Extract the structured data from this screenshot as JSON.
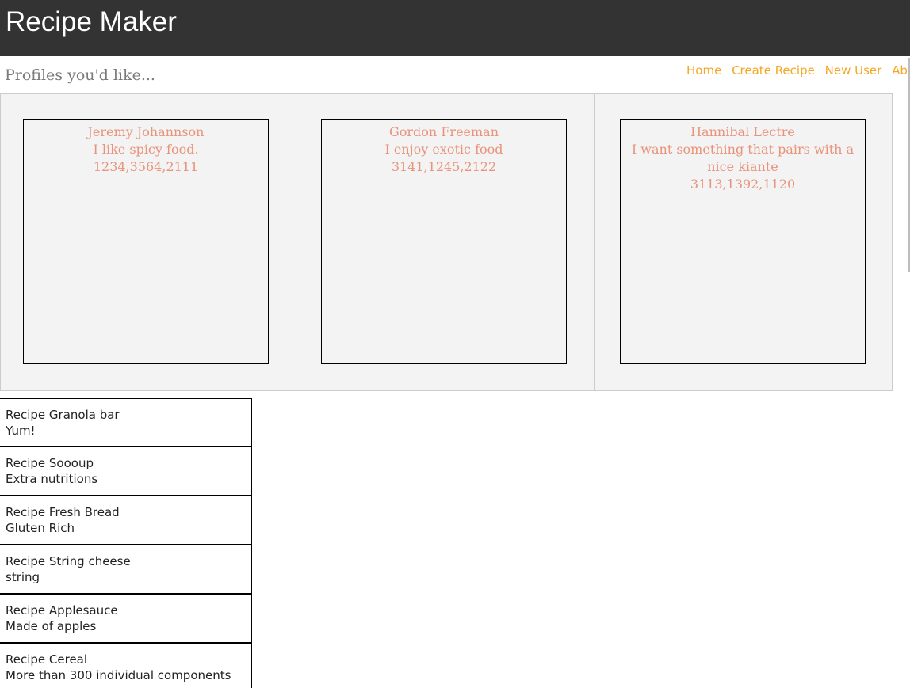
{
  "header": {
    "title": "Recipe Maker"
  },
  "subtitle": "Profiles you'd like...",
  "nav": {
    "items": [
      {
        "label": "Home"
      },
      {
        "label": "Create Recipe"
      },
      {
        "label": "New User"
      },
      {
        "label": "About"
      }
    ]
  },
  "profiles": [
    {
      "name": "Jeremy Johannson",
      "bio": "I like spicy food.",
      "ids": "1234,3564,2111"
    },
    {
      "name": "Gordon Freeman",
      "bio": "I enjoy exotic food",
      "ids": "3141,1245,2122"
    },
    {
      "name": "Hannibal Lectre",
      "bio": "I want something that pairs with a nice kiante",
      "ids": "3113,1392,1120"
    }
  ],
  "recipes": [
    {
      "title": "Recipe Granola bar",
      "description": "Yum!"
    },
    {
      "title": "Recipe Soooup",
      "description": "Extra nutritions"
    },
    {
      "title": "Recipe Fresh Bread",
      "description": "Gluten Rich"
    },
    {
      "title": "Recipe String cheese",
      "description": "string"
    },
    {
      "title": "Recipe Applesauce",
      "description": "Made of apples"
    },
    {
      "title": "Recipe Cereal",
      "description": "More than 300 individual components"
    }
  ],
  "colors": {
    "header_bg": "#333333",
    "nav_link": "#f5a623",
    "profile_text": "#e8937a",
    "profile_cell_bg": "#f3f3f3"
  }
}
